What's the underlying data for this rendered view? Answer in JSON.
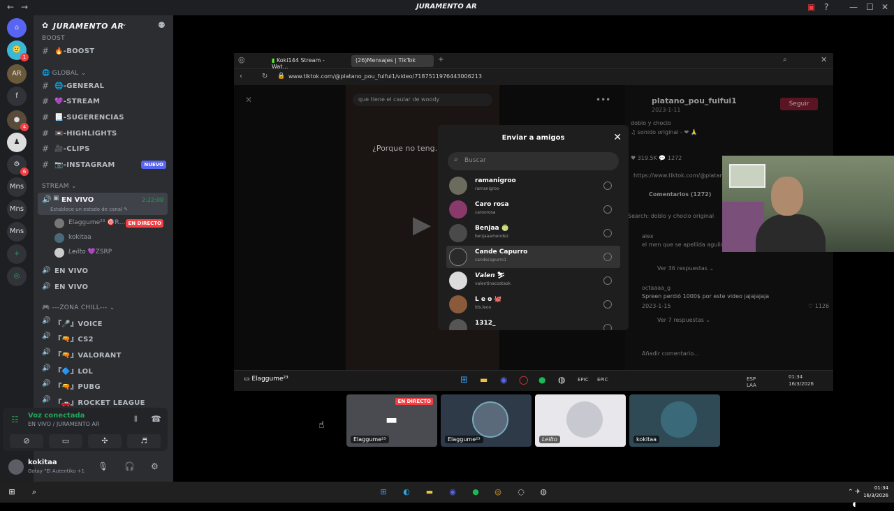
{
  "window": {
    "title": "JURAMENTO AR"
  },
  "servers": [
    {
      "label": "⌂",
      "badge": ""
    },
    {
      "label": "🙂",
      "badge": "1"
    },
    {
      "label": "AR",
      "badge": ""
    },
    {
      "label": "f",
      "badge": ""
    },
    {
      "label": "●",
      "badge": "4"
    },
    {
      "label": "♟",
      "badge": ""
    },
    {
      "label": "⚙",
      "badge": "6"
    },
    {
      "label": "Mns",
      "badge": ""
    },
    {
      "label": "Mns",
      "badge": ""
    },
    {
      "label": "Mns",
      "badge": ""
    },
    {
      "label": "+",
      "badge": ""
    },
    {
      "label": "◎",
      "badge": ""
    }
  ],
  "guild": {
    "name": "JURAMENTO AR",
    "categories": {
      "boost_partial": "BOOST",
      "global": "GLOBAL",
      "stream": "STREAM",
      "zona": "---ZONA CHILL---"
    },
    "text_channels": [
      {
        "label": "🔥-BOOST"
      },
      {
        "label": "🌐-GENERAL"
      },
      {
        "label": "💜-STREAM"
      },
      {
        "label": "📃-SUGERENCIAS"
      },
      {
        "label": "📼-HIGHLIGHTS"
      },
      {
        "label": "🎥-CLIPS"
      },
      {
        "label": "📷-INSTAGRAM",
        "badge": "NUEVO"
      }
    ],
    "active_voice": {
      "label": "EN VIVO",
      "time": "2:22:00",
      "sub": "Establece un estado de canal ✎"
    },
    "voice_users": [
      {
        "name": "Elaggume²³ 🎯R…",
        "badge": "EN DIRECTO"
      },
      {
        "name": "kokitaa",
        "badge": ""
      },
      {
        "name": "𝘓𝘦𝘪𝘭𝘵𝘰 💜ZSRP",
        "badge": ""
      }
    ],
    "voice_channels": [
      {
        "label": "EN VIVO"
      },
      {
        "label": "EN VIVO"
      },
      {
        "label": "『🎤』VOICE"
      },
      {
        "label": "『🔫』CS2"
      },
      {
        "label": "『🔫』VALORANT"
      },
      {
        "label": "『🔷』LOL"
      },
      {
        "label": "『🔫』PUBG"
      },
      {
        "label": "『🚗』ROCKET LEAGUE"
      }
    ]
  },
  "voice_panel": {
    "status": "Voz conectada",
    "channel": "EN VIVO / JURAMENTO AR"
  },
  "user_panel": {
    "name": "kokitaa",
    "status": "Gotay \"El Autentiko +1"
  },
  "browser": {
    "tabs": [
      "Koki144 Stream - Wat…",
      "(26)Mensajes | TikTok"
    ],
    "url": "www.tiktok.com/@platano_pou_fuifui1/video/7187511976443006213",
    "video_search": "que tiene el caular de woody",
    "video_caption": "¿Porque no teng…",
    "right": {
      "username": "platano_pou_fuifui1",
      "date": "2023-1-11",
      "follow": "Seguir",
      "desc": "doblo y choclo",
      "sound": "♫ sonido original - ❤ 🙏",
      "stats": "♥ 319.5K   💬 1272",
      "link": "https://www.tiktok.com/@platano…",
      "comments_title": "Comentarios (1272)",
      "search_hint": "Search: doblo y choclo original",
      "c1_user": "alex",
      "c1_text": "el men que se apellida aguila",
      "c1_replies": "Ver 36 respuestas ⌄",
      "c2_user": "octaaaa_g",
      "c2_text": "Spreen perdió 1000$ por este video jajajajaja",
      "c2_date": "2023-1-15",
      "c2_likes": "♡ 1126",
      "c2_replies": "Ver 7 respuestas ⌄",
      "add_comment": "Añadir comentario..."
    }
  },
  "share_modal": {
    "title": "Enviar a amigos",
    "search_placeholder": "Buscar",
    "friends": [
      {
        "name": "ramanigroo",
        "user": "ramanigroo",
        "color": "#6b6b5e"
      },
      {
        "name": "Caro rosa",
        "user": "caroorosa",
        "color": "#8a3a6a"
      },
      {
        "name": "Benjaa 🍈",
        "user": "benjaaamendez",
        "color": "#4a4a4a"
      },
      {
        "name": "Cande Capurro",
        "user": "candecapurro1",
        "color": "#2a2a2a"
      },
      {
        "name": "𝙑𝙖𝙡𝙚𝙣 ⛷",
        "user": "valentinacostaok",
        "color": "#dcdcdc"
      },
      {
        "name": "L e o 🐙",
        "user": "lds.leoo",
        "color": "#8a5a3a"
      },
      {
        "name": "1312_",
        "user": "",
        "color": "#555555"
      }
    ]
  },
  "browser_taskbar": {
    "streamer": "Elaggume²³",
    "lang": "ESP\nLAA",
    "time": "01:34",
    "date": "16/3/2026"
  },
  "tiles": [
    {
      "name": "Elaggume²³",
      "live": "EN DIRECTO",
      "color": "#4a4b50"
    },
    {
      "name": "Elaggume²³",
      "live": "",
      "color": "#5a6a7a"
    },
    {
      "name": "𝘓𝘦𝘪𝘭𝘵𝘰",
      "live": "",
      "color": "#c8c8d0"
    },
    {
      "name": "kokitaa",
      "live": "",
      "color": "#3a6a7a"
    }
  ],
  "taskbar": {
    "time": "01:34",
    "date": "16/3/2026"
  }
}
